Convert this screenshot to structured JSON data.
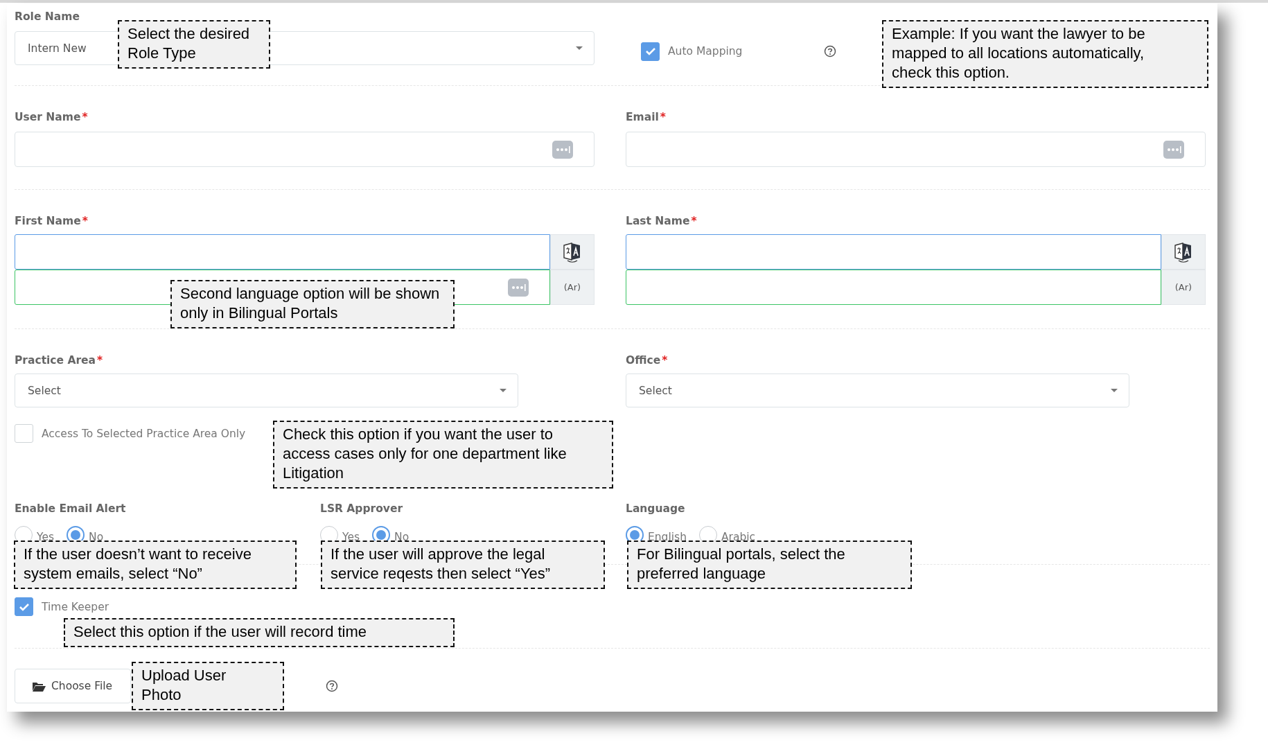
{
  "role": {
    "label": "Role Name",
    "value": "Intern New"
  },
  "auto_mapping": {
    "label": "Auto Mapping",
    "checked": true
  },
  "user_name": {
    "label": "User Name",
    "asterisk": "*"
  },
  "email": {
    "label": "Email",
    "asterisk": "*"
  },
  "first_name": {
    "label": "First Name",
    "asterisk": "*",
    "second_tag": "(Ar)"
  },
  "last_name": {
    "label": "Last Name",
    "asterisk": "*",
    "second_tag": "(Ar)"
  },
  "practice_area": {
    "label": "Practice Area",
    "asterisk": "*",
    "value": "Select"
  },
  "office": {
    "label": "Office",
    "asterisk": "*",
    "value": "Select"
  },
  "access_selected_only": {
    "label": "Access To Selected Practice Area Only",
    "checked": false
  },
  "email_alert": {
    "label": "Enable Email Alert",
    "options": [
      {
        "label": "Yes",
        "selected": false
      },
      {
        "label": "No",
        "selected": true
      }
    ]
  },
  "lsr_approver": {
    "label": "LSR Approver",
    "options": [
      {
        "label": "Yes",
        "selected": false
      },
      {
        "label": "No",
        "selected": true
      }
    ]
  },
  "language": {
    "label": "Language",
    "options": [
      {
        "label": "English",
        "selected": true
      },
      {
        "label": "Arabic",
        "selected": false
      }
    ]
  },
  "time_keeper": {
    "label": "Time Keeper",
    "checked": true
  },
  "photo": {
    "button": "Choose File"
  },
  "callouts": [
    {
      "text": "Select the desired Role Type"
    },
    {
      "text": "Example: If you want the lawyer to be mapped to all locations automatically, check this option."
    },
    {
      "text": "Second language option will be shown only in Bilingual Portals"
    },
    {
      "text": "Check this option if you want the user to access cases only for one department like Litigation"
    },
    {
      "text": "If the user doesn’t want to receive system emails, select “No”"
    },
    {
      "text": "If the user will approve the legal service reqests then select “Yes”"
    },
    {
      "text": "For Bilingual portals, select the preferred language"
    },
    {
      "text": "Select this option if the user will record time"
    },
    {
      "text": "Upload User Photo"
    }
  ]
}
